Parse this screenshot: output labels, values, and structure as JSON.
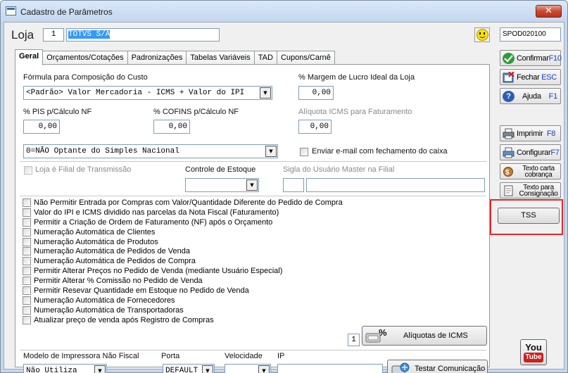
{
  "window": {
    "title": "Cadastro de Parâmetros",
    "close_label": "✕"
  },
  "header": {
    "loja_label": "Loja",
    "loja_number": "1",
    "loja_name": "TOTVS S/A",
    "code": "SPOD020100"
  },
  "tabs": [
    {
      "label": "Geral"
    },
    {
      "label": "Orçamentos/Cotações"
    },
    {
      "label": "Padronizações"
    },
    {
      "label": "Tabelas Variáveis"
    },
    {
      "label": "TAD"
    },
    {
      "label": "Cupons/Carnê"
    }
  ],
  "geral": {
    "formula_label": "Fórmula para Composição do Custo",
    "formula_value": "<Padrão> Valor Mercadoria - ICMS + Valor do IPI",
    "margem_label": "% Margem de Lucro Ideal da Loja",
    "margem_value": "0,00",
    "pis_label": "% PIS p/Cálculo NF",
    "pis_value": "0,00",
    "cofins_label": "% COFINS p/Cálculo NF",
    "cofins_value": "0,00",
    "aliquota_icms_label": "Alíquota ICMS para Faturamento",
    "aliquota_icms_value": "0,00",
    "simples_value": "0=NÃO Optante do Simples Nacional",
    "enviar_email_label": "Enviar e-mail com fechamento do caixa",
    "filial_label": "Loja é Filial de Transmissão",
    "controle_estoque_label": "Controle de Estoque",
    "sigla_label": "Sigla do Usuário Master na Filial",
    "options": [
      "Não Permitir Entrada por Compras com Valor/Quantidade Diferente do Pedido de Compra",
      "Valor do IPI e ICMS dividido nas parcelas da Nota Fiscal (Faturamento)",
      "Permitir a Criação de Ordem de Faturamento (NF) após o Orçamento",
      "Numeração Automática de Clientes",
      "Numeração Automática de Produtos",
      "Numeração Automática de Pedidos de Venda",
      "Numeração Automática de Pedidos de Compra",
      "Permitir Alterar Preços no Pedido de Venda (mediante Usuário Especial)",
      "Permitir Alterar % Comissão no Pedido de Venda",
      "Permitir Resevar Quantidade em Estoque no Pedido de Venda",
      "Numeração Automática de Fornecedores",
      "Numeração Automática de Transportadoras",
      "Atualizar preço de venda após Registro de Compras"
    ],
    "aliquotas_count": "1",
    "aliquotas_button": "Alíquotas de ICMS",
    "modelo_label": "Modelo de Impressora Não Fiscal",
    "modelo_value": "Não Utiliza",
    "porta_label": "Porta",
    "porta_value": "DEFAULT",
    "velocidade_label": "Velocidade",
    "velocidade_value": "",
    "ip_label": "IP",
    "ip_value": "",
    "testar_button": "Testar Comunicação"
  },
  "sidebar": {
    "confirmar": {
      "label": "Confirmar",
      "key": "F10"
    },
    "fechar": {
      "label": "Fechar",
      "key": "ESC"
    },
    "ajuda": {
      "label": "Ajuda",
      "key": "F1"
    },
    "imprimir": {
      "label": "Imprimir",
      "key": "F8"
    },
    "configurar": {
      "label": "Configurar",
      "key": "F7"
    },
    "texto_carta_1": "Texto carta",
    "texto_carta_2": "cobrança",
    "texto_consig_1": "Texto para",
    "texto_consig_2": "Consignação",
    "tss": "TSS",
    "youtube_top": "You",
    "youtube_bottom": "Tube"
  },
  "colors": {
    "selection": "#3399ff",
    "highlight_box": "#e0282c",
    "shortcut_key": "#1a3fc8"
  }
}
